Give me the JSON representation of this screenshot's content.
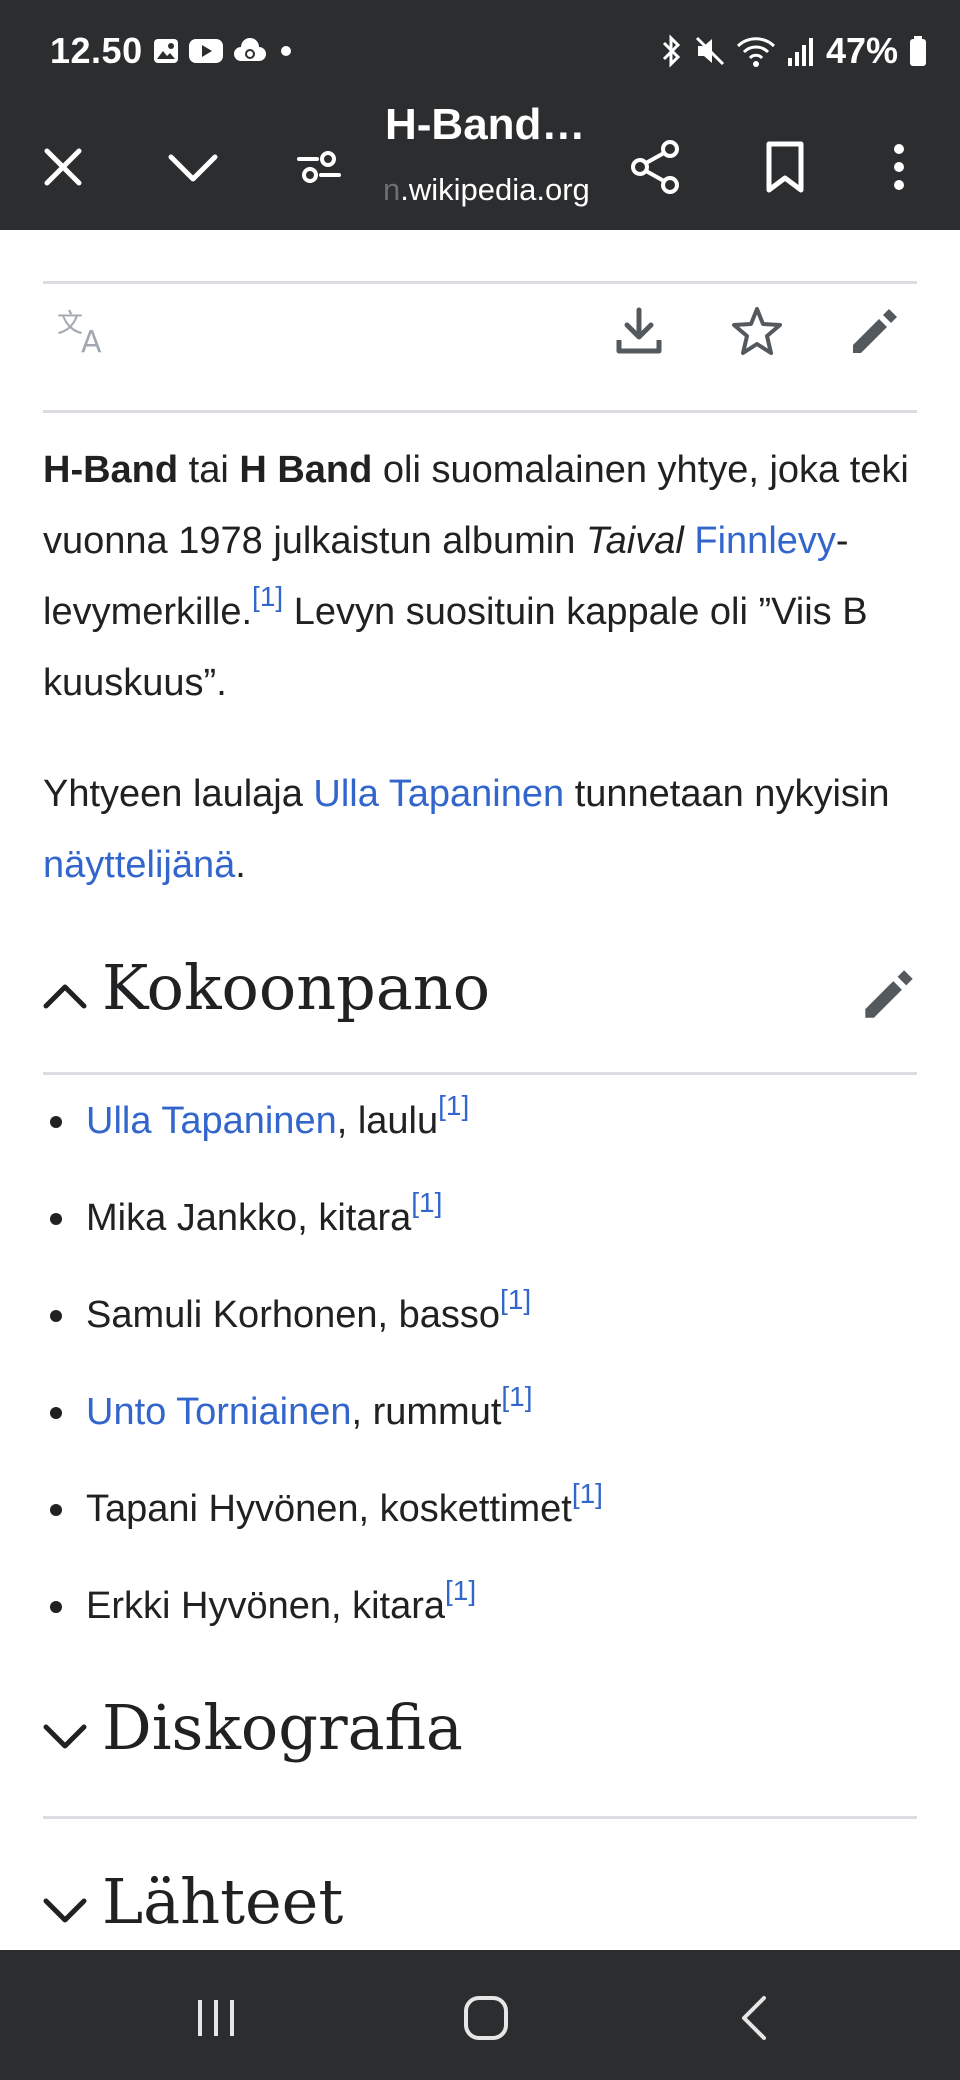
{
  "status_bar": {
    "time": "12.50",
    "battery": "47%",
    "icons_left": [
      "gallery-icon",
      "youtube-icon",
      "cloud-sync-icon",
      "dot-icon"
    ],
    "icons_right": [
      "bluetooth-icon",
      "mute-icon",
      "wifi-icon",
      "signal-icon",
      "battery-icon"
    ]
  },
  "toolbar": {
    "title": "H-Band…",
    "url_faded": "n",
    "url": ".wikipedia.org"
  },
  "article": {
    "intro": {
      "b1": "H-Band",
      "t1": " tai ",
      "b2": "H Band",
      "t2": " oli suomalainen yhtye, joka teki vuonna 1978 julkaistun albumin ",
      "i1": "Taival",
      "t3": " ",
      "link1": "Finnlevy",
      "t4": "-levymerkille.",
      "ref": "[1]",
      "t5": " Levyn suosituin kappale oli ”Viis B kuuskuus”."
    },
    "singer": {
      "t1": "Yhtyeen laulaja ",
      "link1": "Ulla Tapaninen",
      "t2": " tunnetaan nykyisin ",
      "link2": "näyttelijänä",
      "t3": "."
    },
    "sections": {
      "kokoonpano": "Kokoonpano",
      "diskografia": "Diskografia",
      "lahteet": "Lähteet"
    },
    "members": [
      {
        "name": "Ulla Tapaninen",
        "role": ", laulu",
        "ref": "[1]",
        "linked": true
      },
      {
        "name": "Mika Jankko",
        "role": ", kitara",
        "ref": "[1]",
        "linked": false
      },
      {
        "name": "Samuli Korhonen",
        "role": ", basso",
        "ref": "[1]",
        "linked": false
      },
      {
        "name": "Unto Torniainen",
        "role": ", rummut",
        "ref": "[1]",
        "linked": true
      },
      {
        "name": "Tapani Hyvönen",
        "role": ", koskettimet",
        "ref": "[1]",
        "linked": false
      },
      {
        "name": "Erkki Hyvönen",
        "role": ", kitara",
        "ref": "[1]",
        "linked": false
      }
    ]
  },
  "colors": {
    "bars": "#2b2d2f",
    "link": "#3366cc",
    "text": "#202122",
    "icon_gray": "#54595d",
    "divider": "#dcdde0"
  }
}
